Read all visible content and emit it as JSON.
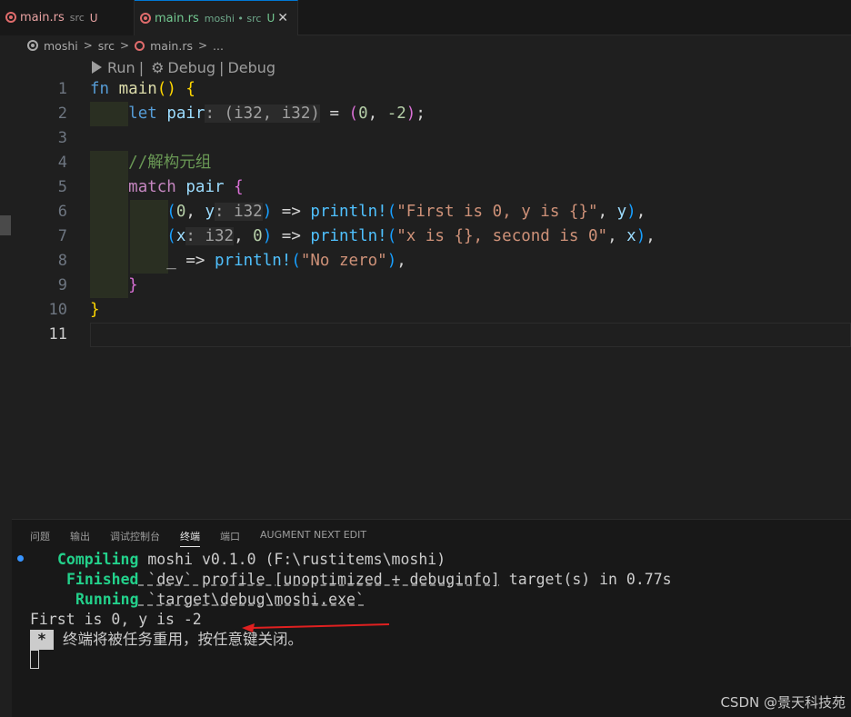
{
  "tabs": [
    {
      "name": "main.rs",
      "folder": "src",
      "status": "U"
    },
    {
      "name": "main.rs",
      "folder": "moshi • src",
      "status": "U",
      "close": "✕"
    }
  ],
  "breadcrumb": {
    "items": [
      "moshi",
      "src",
      "main.rs",
      "..."
    ],
    "separator": ">"
  },
  "codelens": {
    "run": "Run",
    "sep": "|",
    "debug1": "Debug",
    "debug2": "Debug"
  },
  "editor": {
    "line_numbers": [
      "1",
      "2",
      "3",
      "4",
      "5",
      "6",
      "7",
      "8",
      "9",
      "10",
      "11"
    ],
    "lines": [
      "fn main() {",
      "    let pair: (i32, i32) = (0, -2);",
      "",
      "    //解构元组",
      "    match pair {",
      "        (0, y: i32) => println!(\"First is 0, y is {}\", y),",
      "        (x: i32, 0) => println!(\"x is {}, second is 0\", x),",
      "        _ => println!(\"No zero\"),",
      "    }",
      "}",
      ""
    ]
  },
  "panel": {
    "tabs": [
      "问题",
      "输出",
      "调试控制台",
      "终端",
      "端口",
      "AUGMENT NEXT EDIT"
    ],
    "active_tab": "终端",
    "terminal": {
      "compiling_label": "Compiling",
      "compiling_text": " moshi v0.1.0 (F:\\rustitems\\moshi)",
      "finished_label": "Finished",
      "finished_text_a": " `dev` profile [unoptimized + debuginfo]",
      "finished_text_b": " target(s) in 0.77s",
      "running_label": "Running",
      "running_text": " `target\\debug\\moshi.exe`",
      "output": "First is 0, y is -2",
      "star": "*",
      "reuse_msg": "终端将被任务重用，按任意键关闭。"
    }
  },
  "watermark": "CSDN @景天科技苑",
  "colors": {
    "accent": "#0078d4",
    "terminal_green": "#23d18b",
    "arrow_red": "#e02020"
  }
}
